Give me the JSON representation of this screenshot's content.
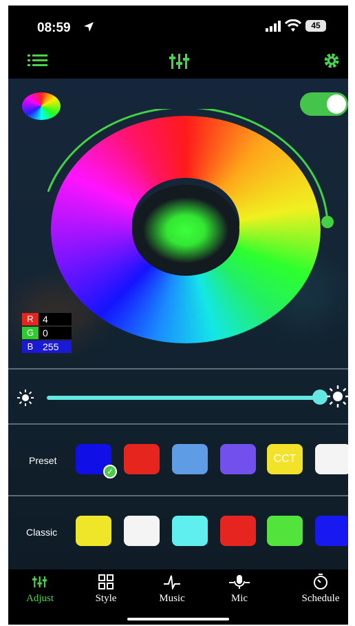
{
  "status": {
    "time": "08:59",
    "battery": "45"
  },
  "colors": {
    "accent": "#64e6e1",
    "tab_active": "#4ad24a",
    "toggle_on": "#44c44a"
  },
  "header": {
    "left_icon": "list-icon",
    "center_icon": "sliders-icon",
    "right_icon": "gear-icon"
  },
  "power_toggle": {
    "on": true
  },
  "rgb": {
    "r_label": "R",
    "r_value": "4",
    "g_label": "G",
    "g_value": "0",
    "b_label": "B",
    "b_value": "255"
  },
  "brightness": {
    "level": 1.0
  },
  "preset": {
    "label": "Preset",
    "swatches": [
      {
        "color": "#1010e6",
        "text": "",
        "selected": true
      },
      {
        "color": "#e6261e",
        "text": ""
      },
      {
        "color": "#5e9ce6",
        "text": ""
      },
      {
        "color": "#7250ee",
        "text": ""
      },
      {
        "color": "#f3e22a",
        "text": "CCT"
      },
      {
        "color": "#f4f4f4",
        "text": ""
      }
    ]
  },
  "classic": {
    "label": "Classic",
    "swatches": [
      {
        "color": "#f0e629",
        "text": ""
      },
      {
        "color": "#f4f4f4",
        "text": ""
      },
      {
        "color": "#5fefef",
        "text": ""
      },
      {
        "color": "#e62520",
        "text": ""
      },
      {
        "color": "#52e33c",
        "text": ""
      },
      {
        "color": "#1818f0",
        "text": ""
      }
    ]
  },
  "tabs": [
    {
      "label": "Adjust",
      "icon": "sliders-icon",
      "active": true
    },
    {
      "label": "Style",
      "icon": "grid-icon",
      "active": false
    },
    {
      "label": "Music",
      "icon": "music-note-icon",
      "active": false
    },
    {
      "label": "Mic",
      "icon": "microphone-icon",
      "active": false
    },
    {
      "label": "Schedule",
      "icon": "timer-icon",
      "active": false
    }
  ]
}
